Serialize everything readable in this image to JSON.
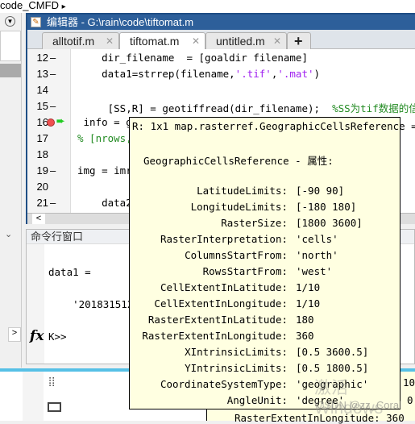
{
  "breadcrumb": {
    "folder": "code_CMFD",
    "arrow": "▸"
  },
  "editor": {
    "title": "编辑器 - G:\\rain\\code\\tiftomat.m",
    "tabs": [
      {
        "label": "alltotif.m",
        "active": false
      },
      {
        "label": "tiftomat.m",
        "active": true
      },
      {
        "label": "untitled.m",
        "active": false
      }
    ],
    "add_tab": "+",
    "lines": [
      {
        "n": "12",
        "dash": "–",
        "code": "    dir_filename  = [goaldir filename]"
      },
      {
        "n": "13",
        "dash": "–",
        "code": "    data1=strrep(filename,'.tif','.mat')"
      },
      {
        "n": "14",
        "dash": "",
        "code": ""
      },
      {
        "n": "15",
        "dash": "–",
        "code": "     [SS,R] = geotiffread(dir_filename);  %SS为tif数据的信息"
      },
      {
        "n": "16",
        "dash": "",
        "code": " info = g"
      },
      {
        "n": "17",
        "dash": "",
        "code": "% [nrows,"
      },
      {
        "n": "18",
        "dash": "",
        "code": ""
      },
      {
        "n": "19",
        "dash": "–",
        "code": "img = imr"
      },
      {
        "n": "20",
        "dash": "",
        "code": ""
      },
      {
        "n": "21",
        "dash": "–",
        "code": "    data2"
      }
    ]
  },
  "command_window": {
    "title": "命令行窗口",
    "output1": "data1 =",
    "output2": "    '201831512r",
    "prompt": "K>>",
    "fx": "fx"
  },
  "tooltip": {
    "header": "R: 1x1 map.rasterref.GeographicCellsReference =",
    "subheader": "GeographicCellsReference - 属性:",
    "props": [
      {
        "k": "LatitudeLimits:",
        "v": "[-90 90]"
      },
      {
        "k": "LongitudeLimits:",
        "v": "[-180 180]"
      },
      {
        "k": "RasterSize:",
        "v": "[1800 3600]"
      },
      {
        "k": "RasterInterpretation:",
        "v": "'cells'"
      },
      {
        "k": "ColumnsStartFrom:",
        "v": "'north'"
      },
      {
        "k": "RowsStartFrom:",
        "v": "'west'"
      },
      {
        "k": "CellExtentInLatitude:",
        "v": "1/10"
      },
      {
        "k": "CellExtentInLongitude:",
        "v": "1/10"
      },
      {
        "k": "RasterExtentInLatitude:",
        "v": "180"
      },
      {
        "k": "RasterExtentInLongitude:",
        "v": "360"
      },
      {
        "k": "XIntrinsicLimits:",
        "v": "[0.5 3600.5]"
      },
      {
        "k": "YIntrinsicLimits:",
        "v": "[0.5 1800.5]"
      },
      {
        "k": "CoordinateSystemType:",
        "v": "'geographic'"
      },
      {
        "k": "AngleUnit:",
        "v": "'degree'"
      }
    ]
  },
  "background_text": {
    "behind1": "10",
    "behind2": "0",
    "bottom_line": "RasterExtentInLongitude: 360"
  },
  "watermark": {
    "activate": "激活 Windows",
    "csdn": "CSDN @zz_Coral"
  }
}
